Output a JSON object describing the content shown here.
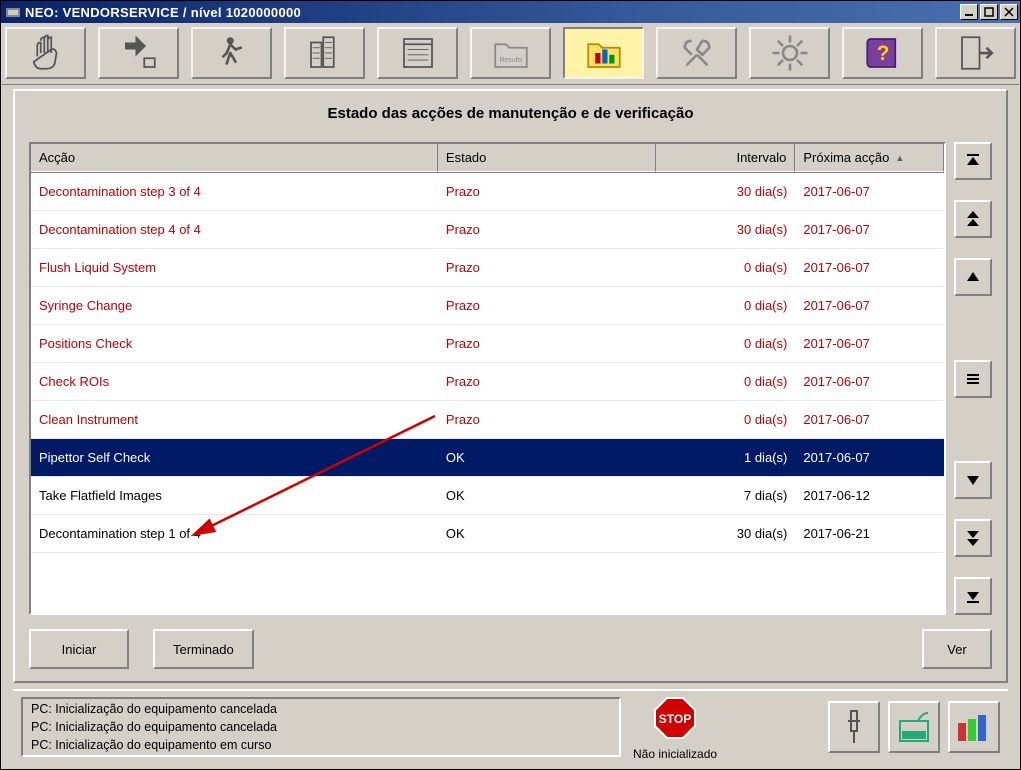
{
  "titlebar": {
    "title": "NEO: VENDORSERVICE / nível 1020000000"
  },
  "panel": {
    "title": "Estado das acções de manutenção e de verificação"
  },
  "columns": {
    "action": "Acção",
    "state": "Estado",
    "interval": "Intervalo",
    "next": "Próxima acção"
  },
  "rows": [
    {
      "action": "Decontamination step 3 of 4",
      "state": "Prazo",
      "interval": "30 dia(s)",
      "next": "2017-06-07",
      "color": "red"
    },
    {
      "action": "Decontamination step 4 of 4",
      "state": "Prazo",
      "interval": "30 dia(s)",
      "next": "2017-06-07",
      "color": "red"
    },
    {
      "action": "Flush Liquid System",
      "state": "Prazo",
      "interval": "0 dia(s)",
      "next": "2017-06-07",
      "color": "red"
    },
    {
      "action": "Syringe Change",
      "state": "Prazo",
      "interval": "0 dia(s)",
      "next": "2017-06-07",
      "color": "red"
    },
    {
      "action": "Positions Check",
      "state": "Prazo",
      "interval": "0 dia(s)",
      "next": "2017-06-07",
      "color": "red"
    },
    {
      "action": "Check ROIs",
      "state": "Prazo",
      "interval": "0 dia(s)",
      "next": "2017-06-07",
      "color": "red"
    },
    {
      "action": "Clean Instrument",
      "state": "Prazo",
      "interval": "0 dia(s)",
      "next": "2017-06-07",
      "color": "red"
    },
    {
      "action": "Pipettor Self Check",
      "state": "OK",
      "interval": "1 dia(s)",
      "next": "2017-06-07",
      "selected": true
    },
    {
      "action": "Take Flatfield Images",
      "state": "OK",
      "interval": "7 dia(s)",
      "next": "2017-06-12"
    },
    {
      "action": "Decontamination step 1 of 4",
      "state": "OK",
      "interval": "30 dia(s)",
      "next": "2017-06-21"
    }
  ],
  "buttons": {
    "start": "Iniciar",
    "finish": "Terminado",
    "view": "Ver"
  },
  "status": {
    "line1": "PC: Inicialização do equipamento cancelada",
    "line2": "PC: Inicialização do equipamento cancelada",
    "line3": "PC: Inicialização do equipamento em curso",
    "state_label": "Não inicializado"
  },
  "icons": {
    "app": "app-icon",
    "stop": "STOP"
  }
}
